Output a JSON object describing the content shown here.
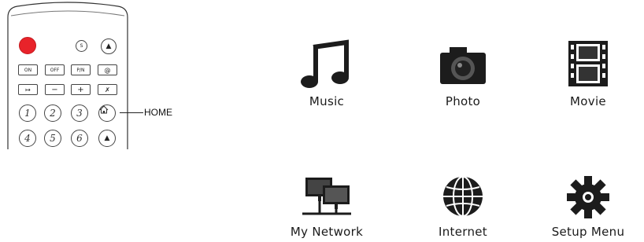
{
  "remote": {
    "buttons_row1": {
      "s": "S",
      "eject": "▲"
    },
    "buttons_row2": [
      "ON",
      "OFF",
      "P/N",
      "@"
    ],
    "buttons_row3": [
      "↦",
      "−",
      "+",
      "✗"
    ],
    "number_keys": [
      "1",
      "2",
      "3",
      "4",
      "5",
      "6"
    ],
    "up_arrow": "▲",
    "home_label": "HOME"
  },
  "menu": {
    "items": [
      {
        "label": "Music",
        "icon": "music-note-icon"
      },
      {
        "label": "Photo",
        "icon": "camera-icon"
      },
      {
        "label": "Movie",
        "icon": "film-strip-icon"
      },
      {
        "label": "My Network",
        "icon": "network-monitors-icon"
      },
      {
        "label": "Internet",
        "icon": "globe-icon"
      },
      {
        "label": "Setup Menu",
        "icon": "gear-icon"
      }
    ]
  },
  "colors": {
    "power_button": "#e8232a",
    "icon_dark": "#1c1c1c"
  }
}
